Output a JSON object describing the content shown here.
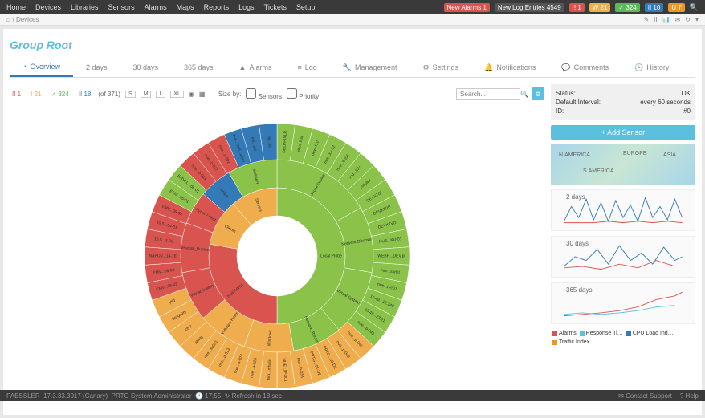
{
  "topnav": {
    "items": [
      "Home",
      "Devices",
      "Libraries",
      "Sensors",
      "Alarms",
      "Maps",
      "Reports",
      "Logs",
      "Tickets",
      "Setup"
    ],
    "newAlarms": {
      "label": "New Alarms",
      "count": "1"
    },
    "newLogs": {
      "label": "New Log Entries",
      "count": "4549"
    },
    "statusBadges": {
      "down": "1",
      "warn": "21",
      "up": "324",
      "paused": "10",
      "unknown": "7"
    }
  },
  "breadcrumb": {
    "path": "Devices"
  },
  "page": {
    "groupTitle": "Group Root"
  },
  "tabs": {
    "overview": "Overview",
    "d2": "2 days",
    "d30": "30 days",
    "d365": "365 days",
    "alarms": "Alarms",
    "log": "Log",
    "management": "Management",
    "settings": "Settings",
    "notifications": "Notifications",
    "comments": "Comments",
    "history": "History"
  },
  "toolbar": {
    "counts": {
      "down": "1",
      "warn": "21",
      "up": "324",
      "paused": "18"
    },
    "ofTotal": "(of 371)",
    "sizes": [
      "S",
      "M",
      "L",
      "XL"
    ],
    "sizeBy": "Size by:",
    "opt1": "Sensors",
    "opt2": "Priority",
    "searchPlaceholder": "Search..."
  },
  "info": {
    "statusLabel": "Status:",
    "statusValue": "OK",
    "intervalLabel": "Default Interval:",
    "intervalValue": "every 60 seconds",
    "idLabel": "ID:",
    "idValue": "#0"
  },
  "addSensor": "+ Add Sensor",
  "map": {
    "labels": [
      "N.AMERICA",
      "EUROPE",
      "ASIA",
      "S.AMERICA"
    ]
  },
  "miniCharts": {
    "c1": "2 days",
    "c2": "30 days",
    "c3": "365 days"
  },
  "legend": {
    "alarms": "Alarms",
    "response": "Response Ti…",
    "cpu": "CPU Load Ind…",
    "traffic": "Traffic Index"
  },
  "footer": {
    "brand": "PAESSLER",
    "version": "17.3.33.3017 (Canary)",
    "user": "PRTG System Administrator",
    "time": "17:55",
    "refresh": "Refresh in 18 sec",
    "contact": "Contact Support",
    "help": "? Help"
  },
  "chart_data": {
    "type": "sunburst",
    "title": "Group Root sensor tree",
    "rings": [
      {
        "level": 1,
        "segments": [
          {
            "name": "Local Probe",
            "value": 180,
            "color": "#8bc34a"
          },
          {
            "name": "NUE-HV01",
            "value": 100,
            "color": "#d9534f"
          },
          {
            "name": "Clients",
            "value": 40,
            "color": "#f0ad4e"
          },
          {
            "name": "Servers",
            "value": 40,
            "color": "#f0ad4e"
          }
        ]
      },
      {
        "level": 2,
        "segments": [
          {
            "name": "Probe Device",
            "value": 60,
            "color": "#8bc34a"
          },
          {
            "name": "Network Discovery",
            "value": 40,
            "color": "#8bc34a"
          },
          {
            "name": "Virtual System",
            "value": 40,
            "color": "#8bc34a"
          },
          {
            "name": "Network_Ructure",
            "value": 30,
            "color": "#8bc34a"
          },
          {
            "name": "Windows",
            "value": 30,
            "color": "#f0ad4e"
          },
          {
            "name": "VMWare Hosts",
            "value": 30,
            "color": "#f0ad4e"
          },
          {
            "name": "Virtual System",
            "value": 30,
            "color": "#d9534f"
          },
          {
            "name": "Network_Ructure",
            "value": 30,
            "color": "#d9534f"
          },
          {
            "name": "HyperV Host",
            "value": 20,
            "color": "#d9534f"
          },
          {
            "name": "Juniper",
            "value": 20,
            "color": "#337ab7"
          },
          {
            "name": "Webserv",
            "value": 30,
            "color": "#8bc34a"
          }
        ]
      },
      {
        "level": 3,
        "segments": [
          {
            "name": "DELPHIXLR",
            "color": "#8bc34a"
          },
          {
            "name": "deva flux",
            "color": "#8bc34a"
          },
          {
            "name": "deva f10",
            "color": "#8bc34a"
          },
          {
            "name": "nue...ku-02",
            "color": "#8bc34a"
          },
          {
            "name": "nue...b-r01",
            "color": "#8bc34a"
          },
          {
            "name": "rod...07c",
            "color": "#8bc34a"
          },
          {
            "name": "roliplex",
            "color": "#8bc34a"
          },
          {
            "name": "DEVX7DL",
            "color": "#8bc34a"
          },
          {
            "name": "DEVX7DP",
            "color": "#8bc34a"
          },
          {
            "name": "DEVX7VD",
            "color": "#8bc34a"
          },
          {
            "name": "NUE...KU-01",
            "color": "#8bc34a"
          },
          {
            "name": "WEBH...DEV.pl",
            "color": "#8bc34a"
          },
          {
            "name": "nue...svr01",
            "color": "#8bc34a"
          },
          {
            "name": "nue...b-c01",
            "color": "#8bc34a"
          },
          {
            "name": "10.49...12.248",
            "color": "#8bc34a"
          },
          {
            "name": "10.49...23.21",
            "color": "#8bc34a"
          },
          {
            "name": "nue...p-049",
            "color": "#8bc34a"
          },
          {
            "name": "nue...p-041",
            "color": "#f0ad4e"
          },
          {
            "name": "nue...p-043",
            "color": "#f0ad4e"
          },
          {
            "name": "PRTG...02-DE",
            "color": "#f0ad4e"
          },
          {
            "name": "PRTG...01-DE",
            "color": "#f0ad4e"
          },
          {
            "name": "nue...b-014",
            "color": "#f0ad4e"
          },
          {
            "name": "NUE...IP-001",
            "color": "#f0ad4e"
          },
          {
            "name": "tara...mhulk",
            "color": "#f0ad4e"
          },
          {
            "name": "nue...a-026",
            "color": "#f0ad4e"
          },
          {
            "name": "nue...a-024",
            "color": "#f0ad4e"
          },
          {
            "name": "nue...a-013",
            "color": "#f0ad4e"
          },
          {
            "name": "nue...sv001",
            "color": "#f0ad4e"
          },
          {
            "name": "alway",
            "color": "#f0ad4e"
          },
          {
            "name": "cty0",
            "color": "#f0ad4e"
          },
          {
            "name": "bergsonj",
            "color": "#f0ad4e"
          },
          {
            "name": "ytld",
            "color": "#f0ad4e"
          },
          {
            "name": "EMV...08-02",
            "color": "#d9534f"
          },
          {
            "name": "EMV...08-04",
            "color": "#d9534f"
          },
          {
            "name": "NAPOV...14-18",
            "color": "#d9534f"
          },
          {
            "name": "10.5...3-03",
            "color": "#d9534f"
          },
          {
            "name": "10.5...04-01",
            "color": "#d9534f"
          },
          {
            "name": "EMV...09-02",
            "color": "#d9534f"
          },
          {
            "name": "EMV...05-01",
            "color": "#8bc34a"
          },
          {
            "name": "EMVLL...de-01",
            "color": "#8bc34a"
          },
          {
            "name": "nue...b-014",
            "color": "#d9534f"
          },
          {
            "name": "nue...b-037",
            "color": "#d9534f"
          },
          {
            "name": "nue...a-001",
            "color": "#d9534f"
          },
          {
            "name": "b-a...Tard...ation",
            "color": "#337ab7"
          },
          {
            "name": "in6...tiol",
            "color": "#337ab7"
          },
          {
            "name": "n6...tiol",
            "color": "#337ab7"
          }
        ]
      }
    ]
  }
}
